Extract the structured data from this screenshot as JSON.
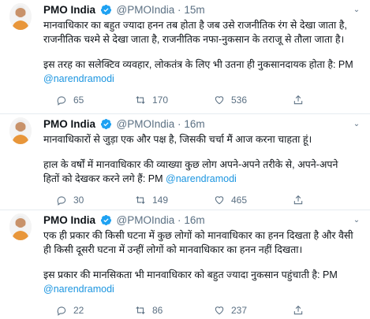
{
  "tweets": [
    {
      "name": "PMO India",
      "handle": "@PMOIndia",
      "dot": "·",
      "time": "15m",
      "lines": [
        "मानवाधिकार का बहुत ज्यादा हनन तब होता है जब उसे राजनीतिक रंग से देखा जाता है,",
        "राजनीतिक चश्मे से देखा जाता है, राजनीतिक नफा-नुकसान के तराजू से तौला जाता है।"
      ],
      "para2": "इस तरह का सलेक्टिव व्यवहार, लोकतंत्र के लिए भी उतना ही नुकसानदायक होता है: PM",
      "mention": "@narendramodi",
      "replies": "65",
      "retweets": "170",
      "likes": "536"
    },
    {
      "name": "PMO India",
      "handle": "@PMOIndia",
      "dot": "·",
      "time": "16m",
      "lines": [
        "मानवाधिकारों से जुड़ा एक और पक्ष है, जिसकी चर्चा मैं आज करना चाहता हूं।"
      ],
      "para2_line1": "हाल के वर्षों में मानवाधिकार की व्याख्या कुछ लोग अपने-अपने तरीके से, अपने-अपने",
      "para2_line2": "हितों को देखकर करने लगे हैं: PM",
      "mention": "@narendramodi",
      "replies": "30",
      "retweets": "149",
      "likes": "465"
    },
    {
      "name": "PMO India",
      "handle": "@PMOIndia",
      "dot": "·",
      "time": "16m",
      "lines": [
        "एक ही प्रकार की किसी घटना में कुछ लोगों को मानवाधिकार का हनन दिखता है और वैसी",
        "ही किसी दूसरी घटना में उन्हीं लोगों को मानवाधिकार का हनन नहीं दिखता।"
      ],
      "para2": "इस प्रकार की मानसिकता भी मानवाधिकार को बहुत ज्यादा नुकसान पहुंचाती है: PM",
      "mention": "@narendramodi",
      "replies": "22",
      "retweets": "86",
      "likes": "237"
    }
  ],
  "icons": {
    "verified": "verified-badge-icon",
    "caret": "chevron-down-icon",
    "reply": "reply-icon",
    "retweet": "retweet-icon",
    "like": "heart-icon",
    "share": "share-icon"
  },
  "colors": {
    "accent": "#1da1f2",
    "mention": "#1b95e0",
    "muted": "#5b7083",
    "divider": "#e6ecf0"
  }
}
